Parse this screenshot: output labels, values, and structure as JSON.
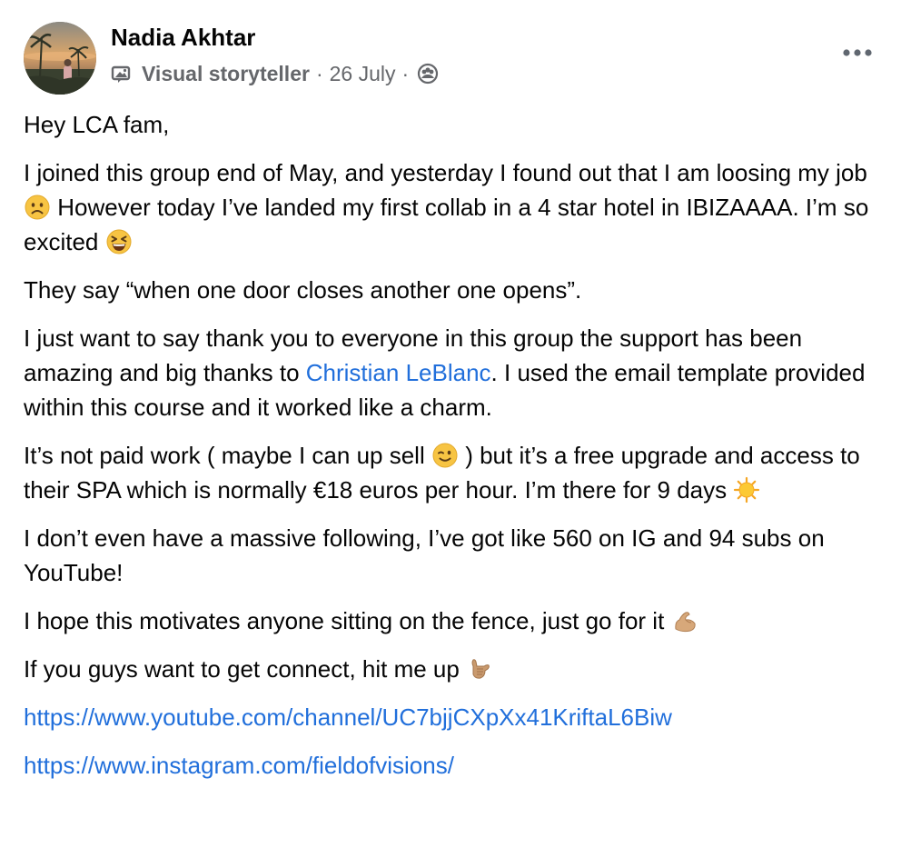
{
  "author": {
    "name": "Nadia Akhtar",
    "badge_label": "Visual storyteller",
    "date": "26 July",
    "separator": "·"
  },
  "icons": {
    "badge": "picture-badge-icon",
    "audience": "group-audience-icon",
    "more": "more-dots-icon"
  },
  "post": {
    "p1": "Hey LCA fam,",
    "p2_a": "I joined this group end of May, and yesterday I found out that I am loosing my job ",
    "p2_b": " However today I’ve landed my first collab in a 4 star hotel in IBIZAAAA. I’m so excited ",
    "p3": "They say “when one door closes another one opens”.",
    "p4_a": "I just want to say thank you to everyone in this group the support has been amazing and big thanks to ",
    "p4_mention": "Christian LeBlanc",
    "p4_b": ". I used the email template provided within this course and it worked like a charm.",
    "p5_a": "It’s not paid work ( maybe I can up sell ",
    "p5_b": " ) but it’s a free upgrade and access to their SPA which is normally €18 euros per hour. I’m there for 9 days ",
    "p6": "I don’t even have a massive following, I’ve got like 560 on IG and 94 subs on YouTube!",
    "p7": "I hope this motivates anyone sitting on the fence, just go for it ",
    "p8": "If you guys want to get connect, hit me up ",
    "link_youtube": "https://www.youtube.com/channel/UC7bjjCXpXx41KriftaL6Biw",
    "link_instagram": "https://www.instagram.com/fieldofvisions/"
  },
  "emojis": {
    "frown": "frowning-face-emoji",
    "laugh": "grinning-squinting-face-emoji",
    "wink": "winking-face-emoji",
    "sun": "sun-emoji",
    "flex": "flexed-biceps-emoji",
    "call": "call-me-hand-emoji"
  },
  "colors": {
    "text": "#050505",
    "secondary": "#65676b",
    "link": "#216fdb"
  }
}
